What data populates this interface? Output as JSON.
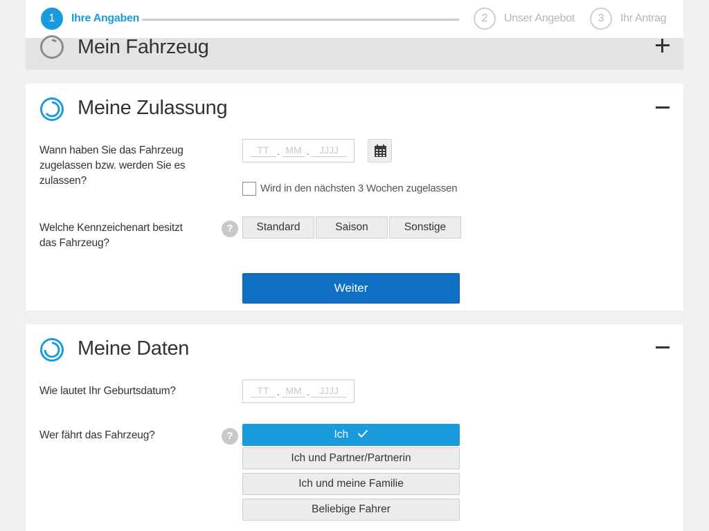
{
  "stepper": {
    "steps": [
      {
        "number": "1",
        "label": "Ihre Angaben",
        "state": "active"
      },
      {
        "number": "2",
        "label": "Unser Angebot",
        "state": "inactive"
      },
      {
        "number": "3",
        "label": "Ihr Antrag",
        "state": "inactive"
      }
    ]
  },
  "sections": {
    "fahrzeug": {
      "title": "Mein Fahrzeug",
      "state": "collapsed"
    },
    "zulassung": {
      "title": "Meine Zulassung",
      "state": "expanded",
      "registration_question": "Wann haben Sie das Fahrzeug zugelassen bzw. werden Sie es zulassen?",
      "date": {
        "day_placeholder": "TT",
        "month_placeholder": "MM",
        "year_placeholder": "JJJJ",
        "separator": "."
      },
      "checkbox_label": "Wird in den nächsten 3 Wochen zugelassen",
      "plate_question": "Welche Kennzeichenart besitzt das Fahrzeug?",
      "help_symbol": "?",
      "plate_options": [
        "Standard",
        "Saison",
        "Sonstige"
      ],
      "continue_label": "Weiter"
    },
    "daten": {
      "title": "Meine Daten",
      "state": "expanded",
      "birthdate_question": "Wie lautet Ihr Geburtsdatum?",
      "date": {
        "day_placeholder": "TT",
        "month_placeholder": "MM",
        "year_placeholder": "JJJJ",
        "separator": "."
      },
      "driver_question": "Wer fährt das Fahrzeug?",
      "help_symbol": "?",
      "driver_options": [
        {
          "label": "Ich",
          "selected": true
        },
        {
          "label": "Ich und Partner/Partnerin",
          "selected": false
        },
        {
          "label": "Ich und meine Familie",
          "selected": false
        },
        {
          "label": "Beliebige Fahrer",
          "selected": false
        }
      ]
    }
  },
  "colors": {
    "accent": "#1a9bdc",
    "primary_button": "#0e6fc4",
    "collapsed_header": "#e3e3e3",
    "background": "#f0f0f0"
  }
}
